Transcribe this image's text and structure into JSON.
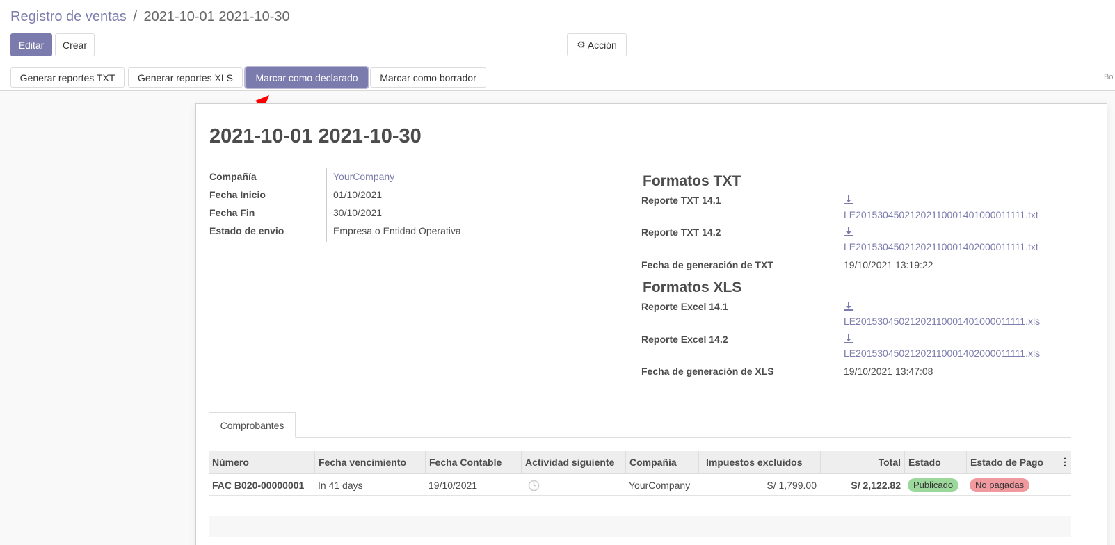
{
  "breadcrumb": {
    "parent": "Registro de ventas",
    "separator": "/",
    "current": "2021-10-01 2021-10-30"
  },
  "toolbar": {
    "edit_label": "Editar",
    "create_label": "Crear",
    "action_label": "Acción"
  },
  "statusbar": {
    "buttons": [
      "Generar reportes TXT",
      "Generar reportes XLS",
      "Marcar como declarado",
      "Marcar como borrador"
    ],
    "right_text": "Bo"
  },
  "record": {
    "title": "2021-10-01 2021-10-30",
    "left_fields": [
      {
        "label": "Compañía",
        "value": "YourCompany"
      },
      {
        "label": "Fecha Inicio",
        "value": "01/10/2021"
      },
      {
        "label": "Fecha Fin",
        "value": "30/10/2021"
      },
      {
        "label": "Estado de envio",
        "value": "Empresa o Entidad Operativa"
      }
    ],
    "txt_section": {
      "title": "Formatos TXT",
      "fields": [
        {
          "label": "Reporte TXT 14.1",
          "file": "LE20153045021202110001401000011111.txt"
        },
        {
          "label": "Reporte TXT 14.2",
          "file": "LE20153045021202110001402000011111.txt"
        }
      ],
      "date_label": "Fecha de generación de TXT",
      "date_value": "19/10/2021 13:19:22"
    },
    "xls_section": {
      "title": "Formatos XLS",
      "fields": [
        {
          "label": "Reporte Excel 14.1",
          "file": "LE20153045021202110001401000011111.xls"
        },
        {
          "label": "Reporte Excel 14.2",
          "file": "LE20153045021202110001402000011111.xls"
        }
      ],
      "date_label": "Fecha de generación de XLS",
      "date_value": "19/10/2021 13:47:08"
    }
  },
  "tabs": [
    "Comprobantes"
  ],
  "grid": {
    "headers": [
      "Número",
      "Fecha vencimiento",
      "Fecha Contable",
      "Actividad siguiente",
      "Compañía",
      "Impuestos excluidos",
      "Total",
      "Estado",
      "Estado de Pago"
    ],
    "rows": [
      {
        "numero": "FAC B020-00000001",
        "vencimiento": "In 41 days",
        "fecha_contable": "19/10/2021",
        "compania": "YourCompany",
        "impuestos": "S/ 1,799.00",
        "total": "S/ 2,122.82",
        "estado": "Publicado",
        "estado_pago": "No pagadas"
      }
    ]
  },
  "colors": {
    "primary": "#7c7bad",
    "badge_success": "#9cd79c",
    "badge_danger": "#f09aa0",
    "arrow": "#ff0000"
  }
}
